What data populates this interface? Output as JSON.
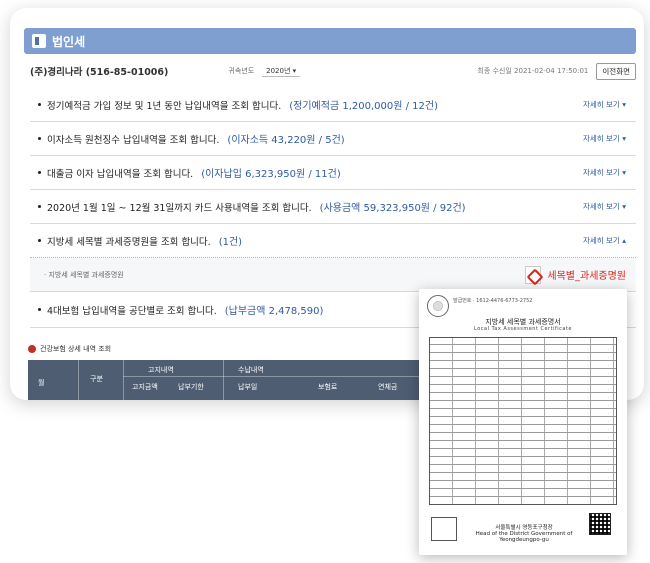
{
  "window": {
    "title": "법인세"
  },
  "info": {
    "company": "(주)경리나라 (516-85-01006)",
    "year_label": "귀속년도",
    "year_value": "2020년",
    "fetch_time": "최종 수신일 2021-02-04 17:50:01",
    "prev_button": "이전화면"
  },
  "rows": [
    {
      "text": "정기예적금 가입 정보 및 1년 동안 납입내역을 조회 합니다.",
      "highlight": "(정기예적금 1,200,000원 / 12건)",
      "more": "자세히 보기"
    },
    {
      "text": "이자소득 원천징수 납입내역을 조회 합니다.",
      "highlight": "(이자소득 43,220원 / 5건)",
      "more": "자세히 보기"
    },
    {
      "text": "대출금 이자 납입내역을 조회 합니다.",
      "highlight": "(이자납입 6,323,950원 / 11건)",
      "more": "자세히 보기"
    },
    {
      "text": "2020년 1월 1일 ~ 12월 31일까지 카드 사용내역을 조회 합니다.",
      "highlight": "(사용금액 59,323,950원 / 92건)",
      "more": "자세히 보기"
    },
    {
      "text": "지방세 세목별 과세증명원을 조회 합니다.",
      "highlight": "(1건)",
      "more": "자세히 보기"
    }
  ],
  "subrow": {
    "label": "· 지방세 세목별 과세증명원",
    "pdf_label": "세목별_과세증명원"
  },
  "row_insurance": {
    "text": "4대보험 납입내역을 공단별로 조회 합니다.",
    "highlight": "(납부금액 2,478,590)"
  },
  "health": {
    "title": "건강보험 상세 내역 조회"
  },
  "table": {
    "col_month": "월",
    "col_type": "구분",
    "group_notice": "고지내역",
    "group_receipt": "수납내역",
    "sub_notice_amount": "고지금액",
    "sub_notice_deadline": "납부기한",
    "sub_receipt_date": "납부일",
    "sub_receipt_amount": "보험료",
    "sub_receipt_late": "연체금"
  },
  "document": {
    "top": "발급번호 · 1612-4476-6773-2752",
    "title": "지방세 세목별 과세증명서",
    "subtitle": "Local Tax Assessment Certificate",
    "footer": "서울특별시 영등포구청장",
    "footer_en": "Head of the District Government of Yeongdeungpo-gu"
  },
  "colors": {
    "title_bar": "#7f9fd1",
    "link": "#2e5aa0",
    "pdf_red": "#d9241b",
    "table_head": "#4e5d72"
  }
}
